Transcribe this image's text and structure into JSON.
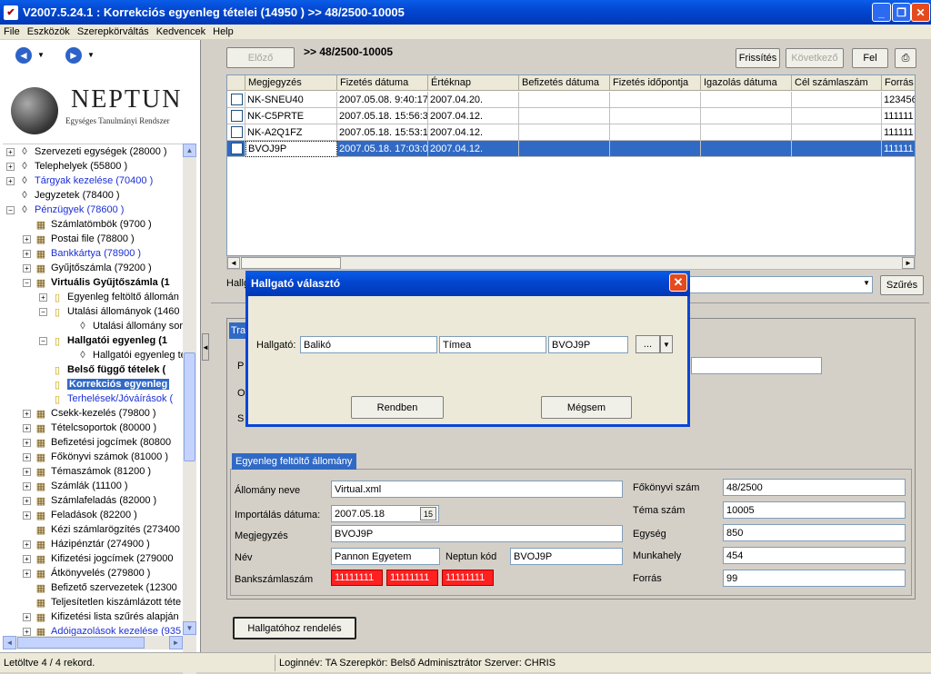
{
  "window": {
    "title": "V2007.5.24.1 : Korrekciós egyenleg tételei (14950  )  >> 48/2500-10005"
  },
  "menu": [
    "File",
    "Eszközök",
    "Szerepkörváltás",
    "Kedvencek",
    "Help"
  ],
  "logo": {
    "title": "NEPTUN",
    "subtitle": "Egységes Tanulmányi Rendszer"
  },
  "tree": [
    {
      "label": "Szervezeti egységek (28000  )",
      "style": "normal"
    },
    {
      "label": "Telephelyek (55800  )",
      "style": "normal"
    },
    {
      "label": "Tárgyak kezelése (70400  )",
      "style": "blue"
    },
    {
      "label": "Jegyzetek (78400  )",
      "style": "normal"
    },
    {
      "label": "Pénzügyek (78600  )",
      "style": "blue"
    },
    {
      "label": "Számlatömbök (9700  )",
      "style": "normal"
    },
    {
      "label": "Postai file (78800  )",
      "style": "normal"
    },
    {
      "label": "Bankkártya (78900  )",
      "style": "blue"
    },
    {
      "label": "Gyűjtőszámla (79200  )",
      "style": "normal"
    },
    {
      "label": "Virtuális Gyűjtőszámla (1",
      "style": "bold"
    },
    {
      "label": "Egyenleg feltöltő állomán",
      "style": "normal"
    },
    {
      "label": "Utalási állományok (1460",
      "style": "normal"
    },
    {
      "label": "Utalási állomány sora",
      "style": "normal"
    },
    {
      "label": "Hallgatói egyenleg (1",
      "style": "bold"
    },
    {
      "label": "Hallgatói egyenleg té",
      "style": "normal"
    },
    {
      "label": "Belső függő tételek (",
      "style": "bold"
    },
    {
      "label": "Korrekciós egyenleg",
      "style": "selected"
    },
    {
      "label": "Terhelések/Jóváírások (",
      "style": "blue"
    },
    {
      "label": "Csekk-kezelés (79800  )",
      "style": "normal"
    },
    {
      "label": "Tételcsoportok (80000  )",
      "style": "normal"
    },
    {
      "label": "Befizetési jogcímek (80800",
      "style": "normal"
    },
    {
      "label": "Főkönyvi számok (81000  )",
      "style": "normal"
    },
    {
      "label": "Témaszámok (81200  )",
      "style": "normal"
    },
    {
      "label": "Számlák (11100  )",
      "style": "normal"
    },
    {
      "label": "Számlafeladás (82000  )",
      "style": "normal"
    },
    {
      "label": "Feladások (82200  )",
      "style": "normal"
    },
    {
      "label": "Kézi számlarögzítés (273400",
      "style": "normal"
    },
    {
      "label": "Házipénztár (274900  )",
      "style": "normal"
    },
    {
      "label": "Kifizetési jogcímek (279000",
      "style": "normal"
    },
    {
      "label": "Átkönyvelés (279800  )",
      "style": "normal"
    },
    {
      "label": "Befizető szervezetek (12300",
      "style": "normal"
    },
    {
      "label": "Teljesítetlen kiszámlázott téte",
      "style": "normal"
    },
    {
      "label": "Kifizetési lista szűrés alapján",
      "style": "normal"
    },
    {
      "label": "Adóigazolások kezelése (935",
      "style": "blue"
    }
  ],
  "toolbar": {
    "prev": "Előző",
    "path": ">> 48/2500-10005",
    "refresh": "Frissítés",
    "next": "Következő",
    "up": "Fel"
  },
  "grid": {
    "columns": [
      "Megjegyzés",
      "Fizetés dátuma",
      "Értéknap",
      "Befizetés dátuma",
      "Fizetés időpontja",
      "Igazolás dátuma",
      "Cél számlaszám",
      "Forrás s"
    ],
    "rows": [
      [
        "NK-SNEU40",
        "2007.05.08. 9:40:17",
        "2007.04.20.",
        "",
        "",
        "",
        "",
        "123456"
      ],
      [
        "NK-C5PRTE",
        "2007.05.18. 15:56:3",
        "2007.04.12.",
        "",
        "",
        "",
        "",
        "111111"
      ],
      [
        "NK-A2Q1FZ",
        "2007.05.18. 15:53:1",
        "2007.04.12.",
        "",
        "",
        "",
        "",
        "111111"
      ],
      [
        "BVOJ9P",
        "2007.05.18. 17:03:0",
        "2007.04.12.",
        "",
        "",
        "",
        "",
        "111111"
      ]
    ]
  },
  "filter": {
    "label": "Hallg",
    "button": "Szűrés"
  },
  "panel": {
    "tab_partial": "Tra",
    "frag1": "P",
    "frag2": "O",
    "frag3": "S"
  },
  "group": {
    "tab": "Egyenleg feltöltő állomány",
    "left": [
      {
        "label": "Állomány neve",
        "value": "Virtual.xml"
      },
      {
        "label": "Importálás dátuma:",
        "value": "2007.05.18"
      },
      {
        "label": "Megjegyzés",
        "value": "BVOJ9P"
      },
      {
        "label": "Név",
        "value": "Pannon Egyetem"
      },
      {
        "label": "Bankszámlaszám",
        "value": ""
      }
    ],
    "neptun_label": "Neptun kód",
    "neptun_value": "BVOJ9P",
    "bank": [
      "11111111",
      "11111111",
      "11111111"
    ],
    "calendar_icon": "15",
    "right": [
      {
        "label": "Főkönyvi szám",
        "value": "48/2500"
      },
      {
        "label": "Téma szám",
        "value": "10005"
      },
      {
        "label": "Egység",
        "value": "850"
      },
      {
        "label": "Munkahely",
        "value": "454"
      },
      {
        "label": "Forrás",
        "value": "99"
      }
    ]
  },
  "assign_button": "Hallgatóhoz rendelés",
  "dialog": {
    "title": "Hallgató választó",
    "label": "Hallgató:",
    "last": "Balikó",
    "first": "Tímea",
    "code": "BVOJ9P",
    "dots": "...",
    "ok": "Rendben",
    "cancel": "Mégsem"
  },
  "status": {
    "left": "Letöltve 4 / 4 rekord.",
    "right": "Loginnév: TA   Szerepkör: Belső Adminisztrátor   Szerver: CHRIS"
  }
}
